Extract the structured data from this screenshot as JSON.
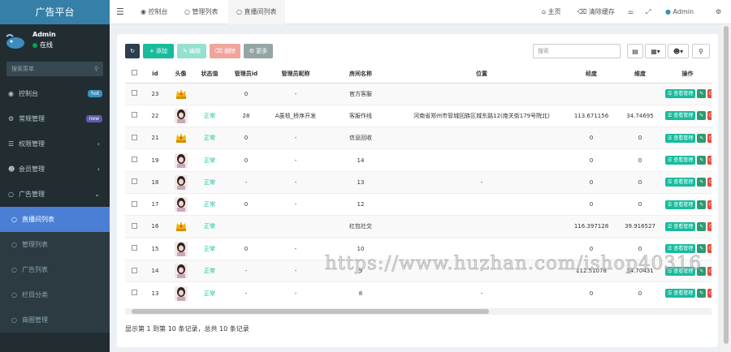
{
  "brand": "广告平台",
  "user": {
    "name": "Admin",
    "status": "在线"
  },
  "sidebar": {
    "search_placeholder": "搜索菜单",
    "items": [
      {
        "label": "控制台",
        "badge": "hot",
        "badge_color": "#3c8dbc"
      },
      {
        "label": "常规管理",
        "badge": "new",
        "badge_color": "#605ca8"
      },
      {
        "label": "权限管理"
      },
      {
        "label": "会员管理"
      },
      {
        "label": "广告管理"
      }
    ],
    "subitems": [
      {
        "label": "直播间列表",
        "active": true
      },
      {
        "label": "管理列表"
      },
      {
        "label": "广告列表"
      },
      {
        "label": "栏目分类"
      },
      {
        "label": "商圈管理"
      }
    ]
  },
  "topbar": {
    "tabs": [
      "控制台",
      "管理列表",
      "直播间列表"
    ],
    "right": [
      "主页",
      "清除缓存",
      "Admin"
    ]
  },
  "toolbar": {
    "add": "添加",
    "edit": "编辑",
    "delete": "删除",
    "more": "更多",
    "search_placeholder": "搜索"
  },
  "table": {
    "headers": [
      "id",
      "头像",
      "状态值",
      "管理员id",
      "管理员昵称",
      "房间名称",
      "位置",
      "经度",
      "维度",
      "操作"
    ],
    "rows": [
      {
        "id": "23",
        "avatar": "crown",
        "status": "",
        "admin_id": "0",
        "admin_name": "-",
        "room": "官方客服",
        "location": "",
        "lng": "",
        "lat": ""
      },
      {
        "id": "22",
        "avatar": "girl",
        "status": "正常",
        "admin_id": "28",
        "admin_name": "A虽毯_桥序开发",
        "room": "客服作线",
        "location": "河南省郑州市管城回族区城东路12(南关街179号院北)",
        "lng": "113.671156",
        "lat": "34.74695"
      },
      {
        "id": "21",
        "avatar": "crown",
        "status": "正常",
        "admin_id": "0",
        "admin_name": "-",
        "room": "信息回收",
        "location": "",
        "lng": "0",
        "lat": "0"
      },
      {
        "id": "19",
        "avatar": "girl",
        "status": "正常",
        "admin_id": "0",
        "admin_name": "-",
        "room": "14",
        "location": "",
        "lng": "0",
        "lat": "0"
      },
      {
        "id": "18",
        "avatar": "girl",
        "status": "正常",
        "admin_id": "-",
        "admin_name": "-",
        "room": "13",
        "location": "-",
        "lng": "0",
        "lat": "0"
      },
      {
        "id": "17",
        "avatar": "girl",
        "status": "正常",
        "admin_id": "0",
        "admin_name": "-",
        "room": "12",
        "location": "",
        "lng": "0",
        "lat": "0"
      },
      {
        "id": "16",
        "avatar": "crown",
        "status": "正常",
        "admin_id": "",
        "admin_name": "",
        "room": "红包社交",
        "location": "",
        "lng": "116.397128",
        "lat": "39.916527"
      },
      {
        "id": "15",
        "avatar": "girl",
        "status": "正常",
        "admin_id": "0",
        "admin_name": "-",
        "room": "10",
        "location": "",
        "lng": "0",
        "lat": "0"
      },
      {
        "id": "14",
        "avatar": "girl",
        "status": "正常",
        "admin_id": "-",
        "admin_name": "-",
        "room": "9",
        "location": "-",
        "lng": "112.51078",
        "lat": "34.70431"
      },
      {
        "id": "13",
        "avatar": "girl",
        "status": "正常",
        "admin_id": "-",
        "admin_name": "-",
        "room": "8",
        "location": "-",
        "lng": "0",
        "lat": "0"
      }
    ],
    "action_label": "查看管理"
  },
  "footer": "显示第 1 到第 10 条记录，总共 10 条记录",
  "watermark": "https://www.huzhan.com/ishop40316"
}
